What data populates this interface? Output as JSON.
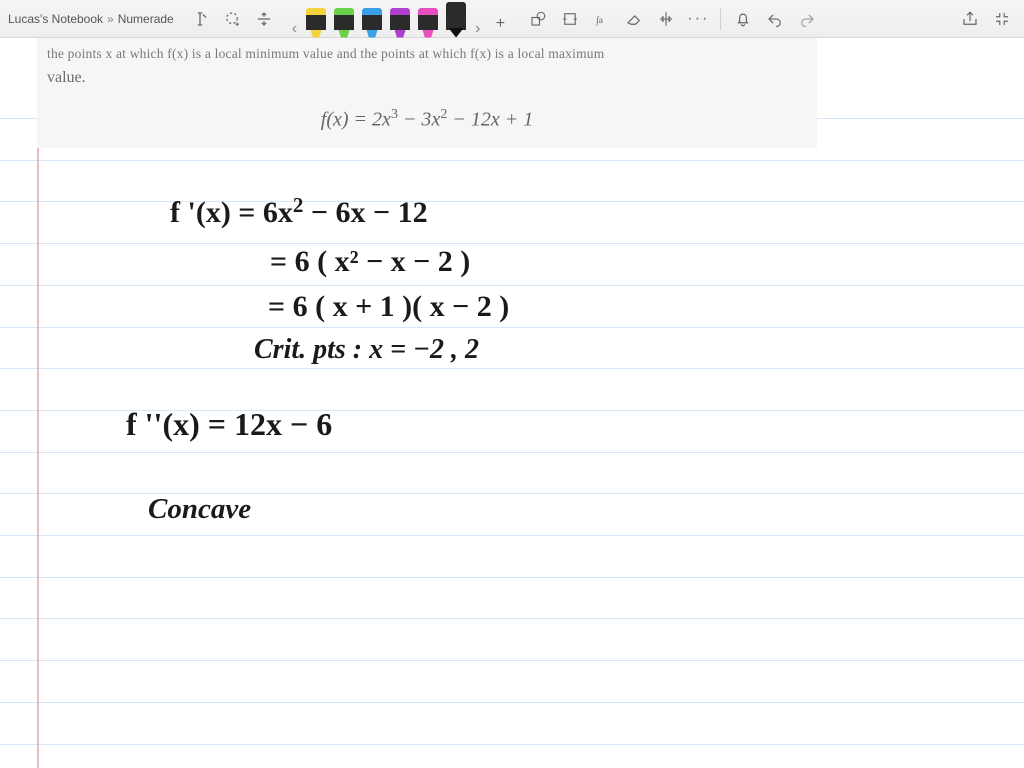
{
  "breadcrumb": {
    "notebook": "Lucas's Notebook",
    "sep": "»",
    "page": "Numerade"
  },
  "pens": [
    {
      "color": "#f4d23c",
      "type": "highlighter"
    },
    {
      "color": "#6bd14a",
      "type": "highlighter"
    },
    {
      "color": "#3aa0e6",
      "type": "highlighter"
    },
    {
      "color": "#b03fcf",
      "type": "highlighter"
    },
    {
      "color": "#e84fbf",
      "type": "highlighter"
    },
    {
      "color": "#111111",
      "type": "pen",
      "active": true
    }
  ],
  "icons": {
    "text": "text-tool-icon",
    "lasso": "lasso-add-icon",
    "insert_space": "insert-space-icon",
    "prev": "‹",
    "next": "›",
    "add_pen": "+",
    "shapes": "shapes-icon",
    "ink_to_shape": "ink-to-shape-icon",
    "ink_to_math": "ink-to-math-icon",
    "eraser": "eraser-icon",
    "ruler": "ruler-icon",
    "more": "···",
    "bell": "bell-icon",
    "undo": "undo-icon",
    "redo": "redo-icon",
    "share": "share-icon",
    "fullscreen": "fullscreen-exit-icon"
  },
  "problem": {
    "truncated_line": "the points x at which f(x) is a local minimum value and the points at which f(x) is a local maximum",
    "value_word": "value.",
    "formula_html": "f(x) = 2x³ − 3x² − 12x + 1"
  },
  "handwriting": {
    "l1": "f '(x) = 6x² − 6x − 12",
    "l2": "= 6 ( x² − x − 2 )",
    "l3": "= 6 ( x + 1 )( x − 2 )",
    "l4": "Crit. pts :   x = −2 ,  2",
    "l5": "f ''(x) =   12x − 6",
    "l6": "Concave"
  },
  "ruled": {
    "start": 80,
    "spacing": 41.7,
    "count": 16
  }
}
